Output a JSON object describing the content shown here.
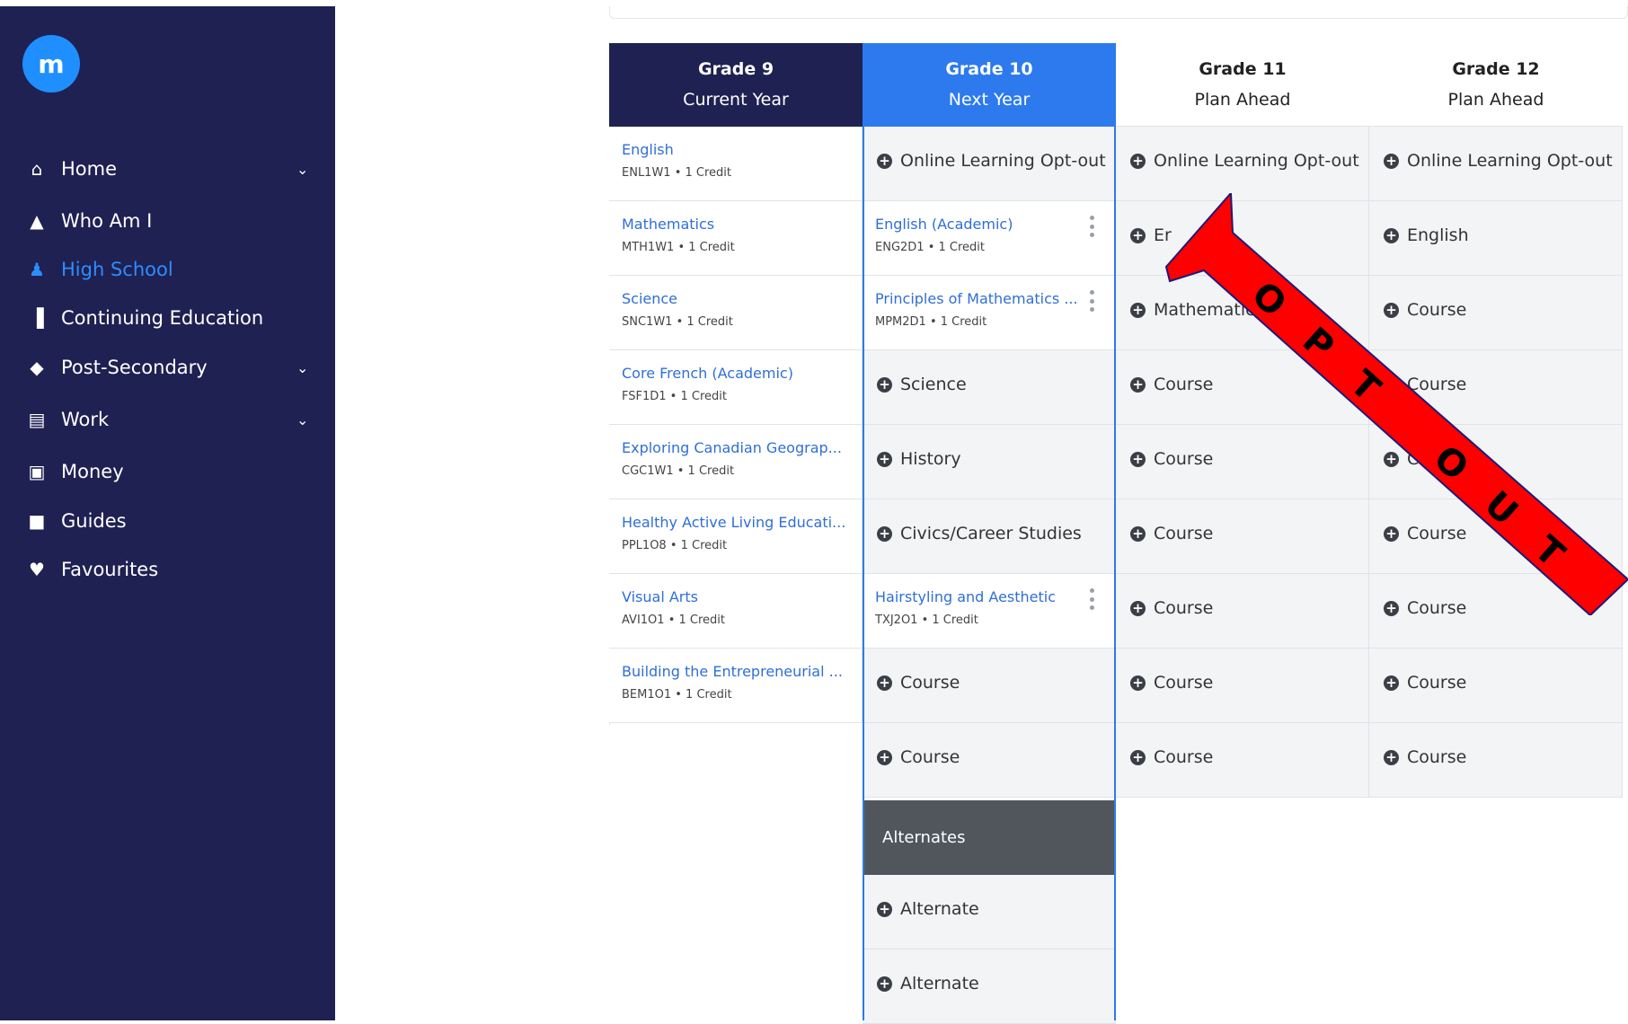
{
  "sidebar": {
    "logo": "m",
    "items": [
      {
        "label": "Home",
        "icon": "home-icon",
        "glyph": "⌂",
        "has_chevron": true
      },
      {
        "label": "Who Am I",
        "icon": "compass-icon",
        "glyph": "▲",
        "has_chevron": false
      },
      {
        "label": "High School",
        "icon": "student-icon",
        "glyph": "♟",
        "has_chevron": false,
        "active": true
      },
      {
        "label": "Continuing Education",
        "icon": "library-icon",
        "glyph": "▐",
        "has_chevron": false
      },
      {
        "label": "Post-Secondary",
        "icon": "graduation-cap-icon",
        "glyph": "◆",
        "has_chevron": true
      },
      {
        "label": "Work",
        "icon": "briefcase-icon",
        "glyph": "▤",
        "has_chevron": true
      },
      {
        "label": "Money",
        "icon": "money-icon",
        "glyph": "▣",
        "has_chevron": false
      },
      {
        "label": "Guides",
        "icon": "book-icon",
        "glyph": "■",
        "has_chevron": false
      },
      {
        "label": "Favourites",
        "icon": "heart-icon",
        "glyph": "♥",
        "has_chevron": false
      }
    ],
    "colors": {
      "background": "#1f2152",
      "active": "#2e8cff"
    }
  },
  "columns": [
    {
      "title": "Grade 9",
      "subtitle": "Current Year"
    },
    {
      "title": "Grade 10",
      "subtitle": "Next Year"
    },
    {
      "title": "Grade 11",
      "subtitle": "Plan Ahead"
    },
    {
      "title": "Grade 12",
      "subtitle": "Plan Ahead"
    }
  ],
  "grade9": [
    {
      "name": "English",
      "meta": "ENL1W1 • 1 Credit"
    },
    {
      "name": "Mathematics",
      "meta": "MTH1W1 • 1 Credit"
    },
    {
      "name": "Science",
      "meta": "SNC1W1 • 1 Credit"
    },
    {
      "name": "Core French (Academic)",
      "meta": "FSF1D1 • 1 Credit"
    },
    {
      "name": "Exploring Canadian Geograp...",
      "meta": "CGC1W1 • 1 Credit"
    },
    {
      "name": "Healthy Active Living Educati...",
      "meta": "PPL1O8 • 1 Credit"
    },
    {
      "name": "Visual Arts",
      "meta": "AVI1O1 • 1 Credit"
    },
    {
      "name": "Building the Entrepreneurial ...",
      "meta": "BEM1O1 • 1 Credit"
    }
  ],
  "grade10": [
    {
      "type": "add",
      "label": "Online Learning Opt-out"
    },
    {
      "type": "course",
      "name": "English (Academic)",
      "meta": "ENG2D1 • 1 Credit"
    },
    {
      "type": "course",
      "name": "Principles of Mathematics ...",
      "meta": "MPM2D1 • 1 Credit"
    },
    {
      "type": "add",
      "label": "Science"
    },
    {
      "type": "add",
      "label": "History"
    },
    {
      "type": "add",
      "label": "Civics/Career Studies"
    },
    {
      "type": "course",
      "name": "Hairstyling and Aesthetic",
      "meta": "TXJ2O1 • 1 Credit"
    },
    {
      "type": "add",
      "label": "Course"
    },
    {
      "type": "add",
      "label": "Course"
    }
  ],
  "grade11": [
    "Online Learning Opt-out",
    "Er",
    "Mathematics",
    "Course",
    "Course",
    "Course",
    "Course",
    "Course",
    "Course"
  ],
  "grade12": [
    "Online Learning Opt-out",
    "English",
    "Course",
    "Course",
    "C",
    "Course",
    "Course",
    "Course",
    "Course"
  ],
  "alternates": {
    "header": "Alternates",
    "items": [
      "Alternate",
      "Alternate"
    ]
  },
  "overlay": {
    "text": "OPT OUT",
    "color": "#ff0000"
  }
}
